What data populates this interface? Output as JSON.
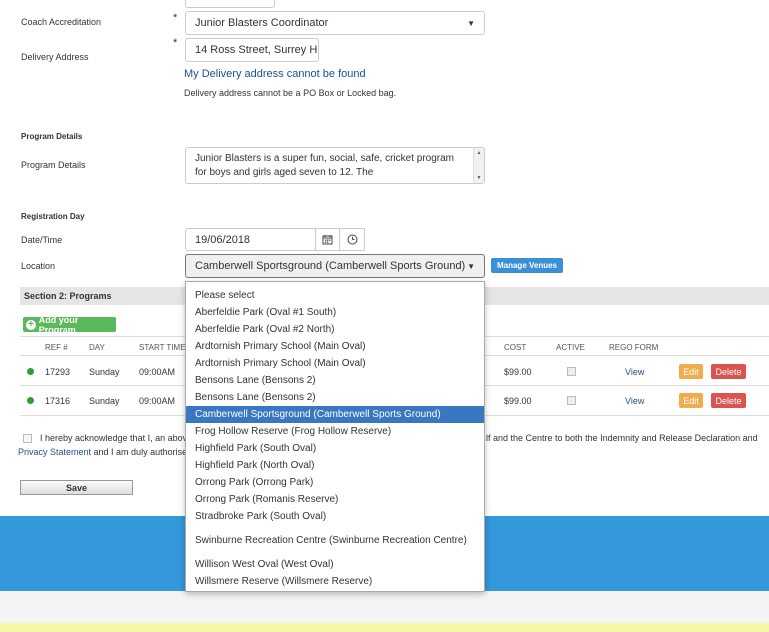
{
  "form": {
    "coach_accreditation_label": "Coach Accreditation",
    "coach_accreditation_value": "Junior Blasters Coordinator",
    "delivery_address_label": "Delivery Address",
    "delivery_address_value": "14 Ross Street, Surrey H",
    "delivery_link": "My Delivery address cannot be found",
    "delivery_note": "Delivery address cannot be a PO Box or Locked bag.",
    "program_details_heading": "Program Details",
    "program_details_label": "Program Details",
    "program_details_text": "Junior Blasters is a super fun, social, safe, cricket program for boys and girls aged seven to 12. The",
    "registration_day_heading": "Registration Day",
    "datetime_label": "Date/Time",
    "date_value": "19/06/2018",
    "location_label": "Location",
    "location_value": "Camberwell Sportsground (Camberwell Sports Ground)",
    "manage_venues": "Manage Venues"
  },
  "section2": {
    "title": "Section 2: Programs",
    "add_program": "Add your Program",
    "columns": [
      "REF #",
      "DAY",
      "START TIME",
      "COST",
      "ACTIVE",
      "REGO FORM"
    ],
    "rows": [
      {
        "ref": "17293",
        "day": "Sunday",
        "start": "09:00AM",
        "cost": "$99.00",
        "view": "View",
        "edit": "Edit",
        "delete": "Delete"
      },
      {
        "ref": "17316",
        "day": "Sunday",
        "start": "09:00AM",
        "cost": "$99.00",
        "view": "View",
        "edit": "Edit",
        "delete": "Delete"
      }
    ]
  },
  "acknowledge": {
    "line1_left": "I hereby acknowledge that I, an abov",
    "line1_right": "lf and the Centre to both the Indemnity and Release Declaration and",
    "line2_left": "Privacy Statement",
    "line2_right": " and I am duly authorise",
    "save": "Save"
  },
  "dropdown": {
    "options": [
      "Please select",
      "Aberfeldie Park (Oval #1 South)",
      "Aberfeldie Park (Oval #2 North)",
      "Ardtornish Primary School (Main Oval)",
      "Ardtornish Primary School (Main Oval)",
      "Bensons Lane (Bensons 2)",
      "Bensons Lane (Bensons 2)",
      "Camberwell Sportsground (Camberwell Sports Ground)",
      "Frog Hollow Reserve (Frog Hollow Reserve)",
      "Highfield Park (South Oval)",
      "Highfield Park (North Oval)",
      "Orrong Park (Orrong Park)",
      "Orrong Park (Romanis Reserve)",
      "Stradbroke Park (South Oval)",
      "Swinburne Recreation Centre (Swinburne Recreation Centre)",
      "Willison West Oval (West Oval)",
      "Willsmere Reserve (Willsmere Reserve)"
    ],
    "selected_index": 7
  },
  "icons": {
    "calendar": "calendar-icon",
    "clock": "clock-icon",
    "plus": "plus-circle-icon"
  },
  "colors": {
    "accent_blue": "#3a8fd9",
    "footer_blue": "#3399db",
    "footer_yellow": "#f7f7a8",
    "link_blue": "#1f4e8c",
    "green": "#5cb85c",
    "orange": "#f0ad4e",
    "red": "#d9534f",
    "selected_option": "#3a77c2"
  }
}
